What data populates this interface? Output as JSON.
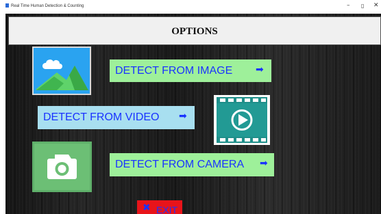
{
  "window": {
    "title": "Real Time Human Detection & Counting",
    "minimize_glyph": "–",
    "maximize_glyph": "▯",
    "close_glyph": "✕"
  },
  "header": {
    "title": "OPTIONS"
  },
  "buttons": {
    "image": {
      "label": "DETECT  FROM   IMAGE",
      "arrow": "➡"
    },
    "video": {
      "label": "DETECT  FROM  VIDEO",
      "arrow": "➡"
    },
    "camera": {
      "label": "DETECT FROM CAMERA",
      "arrow": "➡"
    },
    "exit": {
      "label": "EXIT",
      "icon": "✖"
    }
  },
  "icons": {
    "image": "image-icon",
    "video": "video-play-icon",
    "camera": "camera-icon",
    "exit": "close-icon"
  },
  "colors": {
    "button_green": "#9ef09a",
    "button_blue": "#a8dff0",
    "button_text": "#1a33ff",
    "exit_red": "#e8141a"
  }
}
